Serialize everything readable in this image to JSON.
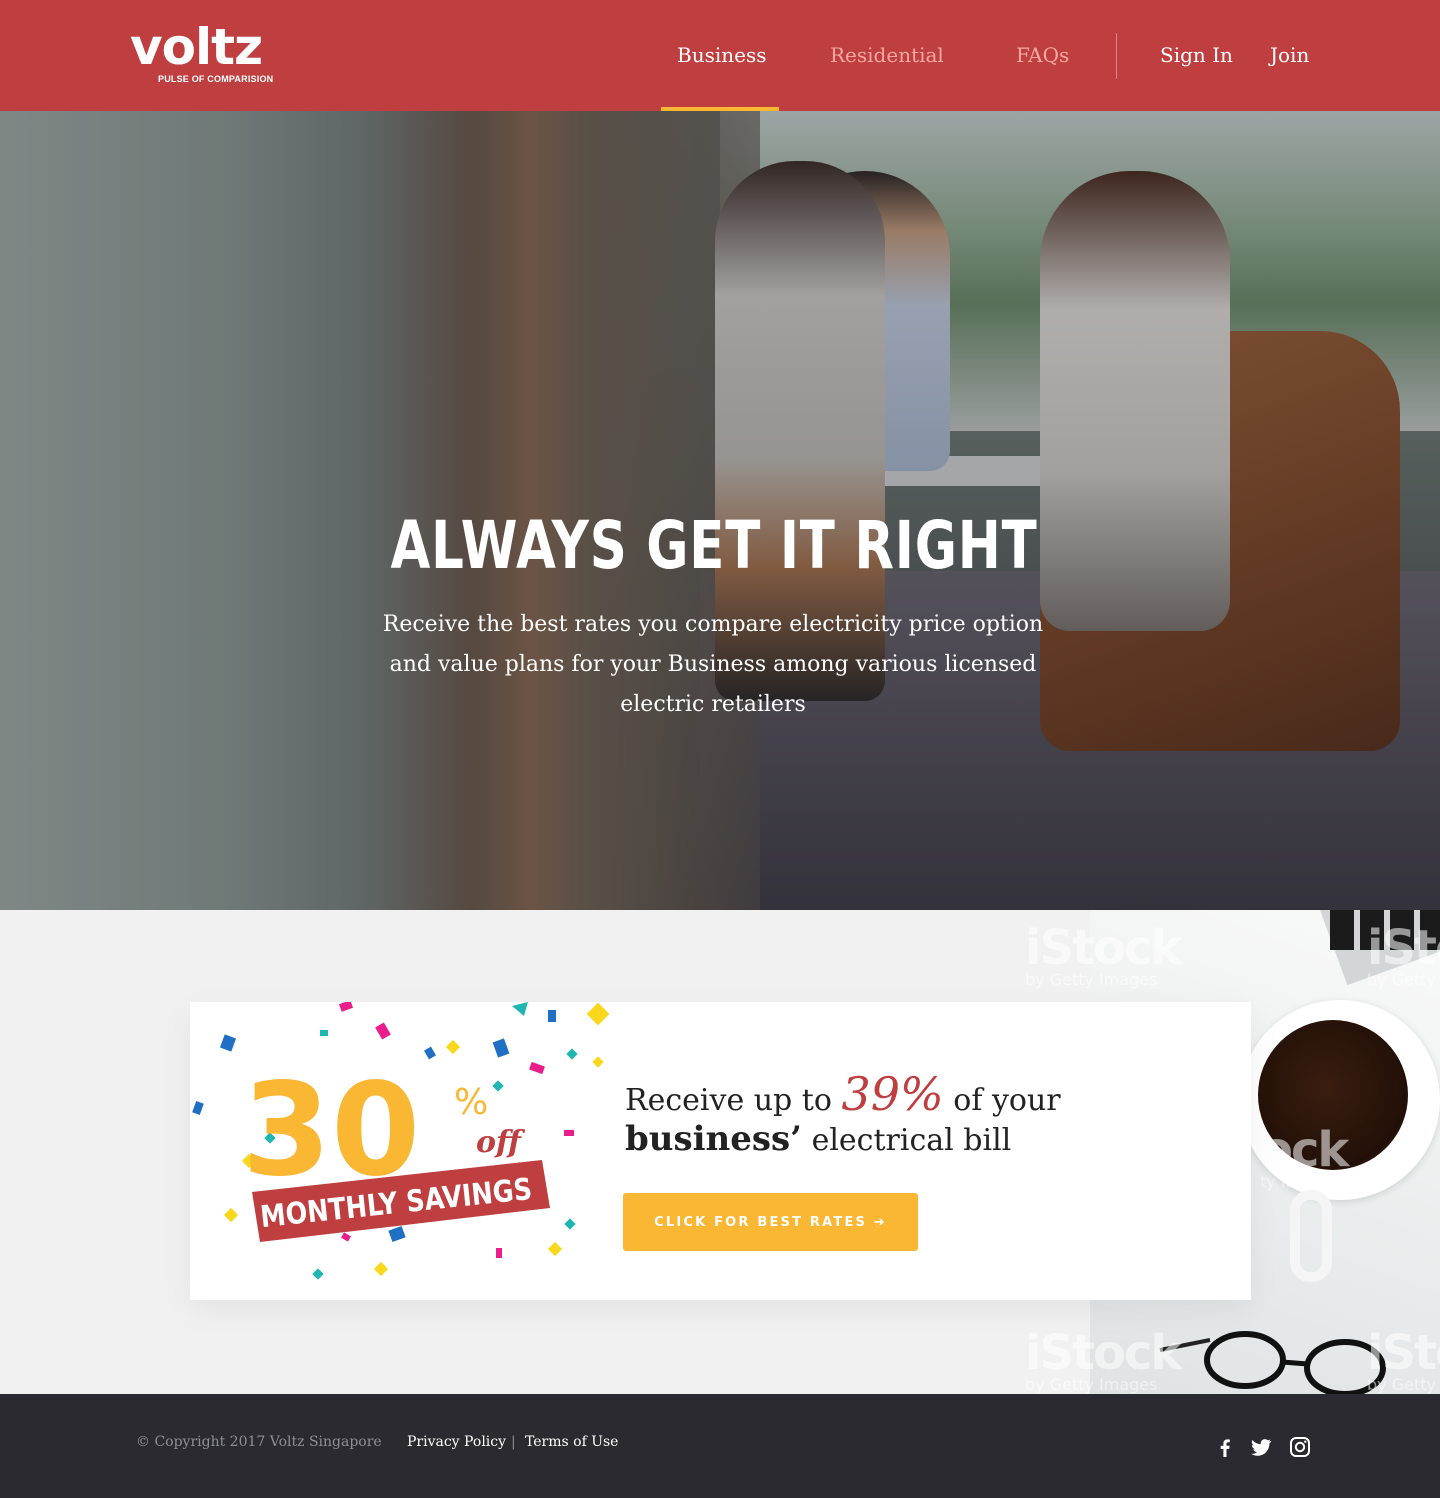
{
  "header": {
    "logo_word": "voltz",
    "logo_tagline": "PULSE OF COMPARISION",
    "nav": {
      "business": "Business",
      "residential": "Residential",
      "faqs": "FAQs",
      "sign_in": "Sign In",
      "join": "Join"
    },
    "active_tab": "Business"
  },
  "hero": {
    "title": "ALWAYS GET IT RIGHT",
    "subtitle": "Receive the best rates you compare electricity price option and value plans for your Business among various licensed electric retailers"
  },
  "promo": {
    "badge_number": "30",
    "badge_percent": "%",
    "badge_off": "off",
    "badge_ribbon": "MONTHLY SAVINGS",
    "line1_prefix": "Receive up to",
    "line1_percent": "39%",
    "line1_suffix": "of your",
    "line2_bold": "business’",
    "line2_rest": "electrical bill",
    "cta_label": "CLICK FOR BEST RATES ➔"
  },
  "watermarks": {
    "brand": "iStock",
    "sub": "by Getty Images",
    "partial_brand": "ock",
    "partial_sub": "ty Images"
  },
  "footer": {
    "copyright": "© Copyright 2017 Voltz Singapore",
    "privacy": "Privacy Policy",
    "separator": "|",
    "terms": "Terms of Use",
    "social": [
      "facebook-icon",
      "twitter-icon",
      "instagram-icon"
    ]
  },
  "colors": {
    "brand_red": "#bf3f40",
    "accent_yellow": "#f9b734",
    "footer_bg": "#2a2a30",
    "nav_inactive": "#f6a8a0"
  }
}
